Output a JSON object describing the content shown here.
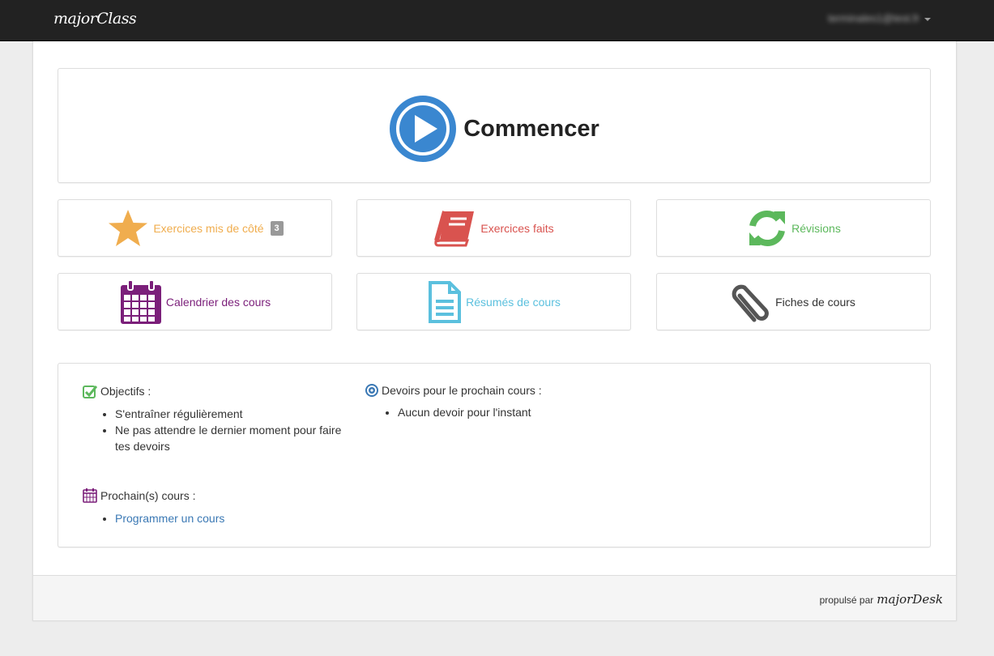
{
  "navbar": {
    "brand": "majorClass",
    "user_email": "terminales1@test.fr"
  },
  "start": {
    "label": "Commencer"
  },
  "tiles": [
    {
      "label": "Exercices mis de côté",
      "badge": "3",
      "color": "#f0ad4e",
      "icon": "star-icon"
    },
    {
      "label": "Exercices faits",
      "color": "#d9534f",
      "icon": "book-icon"
    },
    {
      "label": "Révisions",
      "color": "#5cb85c",
      "icon": "refresh-icon"
    },
    {
      "label": "Calendrier des cours",
      "color": "#7b1f7a",
      "icon": "calendar-icon"
    },
    {
      "label": "Résumés de cours",
      "color": "#5bc0de",
      "icon": "document-icon"
    },
    {
      "label": "Fiches de cours",
      "color": "#333333",
      "icon": "paperclip-icon"
    }
  ],
  "info": {
    "objectives": {
      "title": "Objectifs :",
      "items": [
        "S'entraîner régulièrement",
        "Ne pas attendre le dernier moment pour faire tes devoirs"
      ]
    },
    "homework": {
      "title": "Devoirs pour le prochain cours :",
      "items": [
        "Aucun devoir pour l'instant"
      ]
    },
    "next_courses": {
      "title": "Prochain(s) cours :",
      "link": "Programmer un cours"
    }
  },
  "footer": {
    "powered_by": "propulsé par",
    "logo": "majorDesk"
  }
}
